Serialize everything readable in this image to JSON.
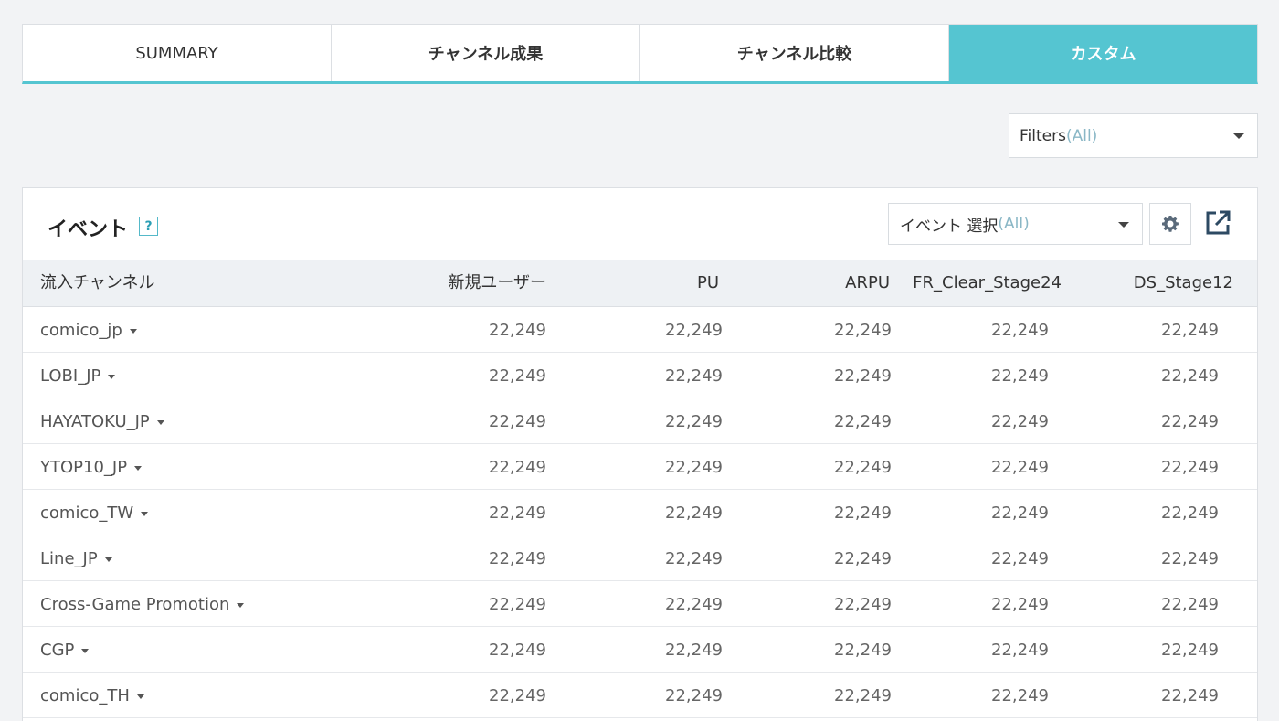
{
  "tabs": [
    {
      "label": "SUMMARY"
    },
    {
      "label": "チャンネル成果"
    },
    {
      "label": "チャンネル比較"
    },
    {
      "label": "カスタム"
    }
  ],
  "filters": {
    "label": "Filters",
    "value": "(All)"
  },
  "panel": {
    "title": "イベント",
    "help": "?",
    "event_select": {
      "label": "イベント 選択",
      "value": "(All)"
    }
  },
  "table": {
    "headers": [
      "流入チャンネル",
      "新規ユーザー",
      "PU",
      "ARPU",
      "FR_Clear_Stage24",
      "DS_Stage12"
    ],
    "rows": [
      {
        "channel": "comico_jp",
        "values": [
          "22,249",
          "22,249",
          "22,249",
          "22,249",
          "22,249"
        ]
      },
      {
        "channel": "LOBI_JP",
        "values": [
          "22,249",
          "22,249",
          "22,249",
          "22,249",
          "22,249"
        ]
      },
      {
        "channel": "HAYATOKU_JP",
        "values": [
          "22,249",
          "22,249",
          "22,249",
          "22,249",
          "22,249"
        ]
      },
      {
        "channel": "YTOP10_JP",
        "values": [
          "22,249",
          "22,249",
          "22,249",
          "22,249",
          "22,249"
        ]
      },
      {
        "channel": "comico_TW",
        "values": [
          "22,249",
          "22,249",
          "22,249",
          "22,249",
          "22,249"
        ]
      },
      {
        "channel": "Line_JP",
        "values": [
          "22,249",
          "22,249",
          "22,249",
          "22,249",
          "22,249"
        ]
      },
      {
        "channel": "Cross-Game Promotion",
        "values": [
          "22,249",
          "22,249",
          "22,249",
          "22,249",
          "22,249"
        ]
      },
      {
        "channel": "CGP",
        "values": [
          "22,249",
          "22,249",
          "22,249",
          "22,249",
          "22,249"
        ]
      },
      {
        "channel": "comico_TH",
        "values": [
          "22,249",
          "22,249",
          "22,249",
          "22,249",
          "22,249"
        ]
      }
    ]
  },
  "colors": {
    "accent": "#55c5d1",
    "header_bg": "#eef1f4",
    "page_bg": "#f2f3f5"
  },
  "icons": {
    "gear": "gear-icon",
    "export": "external-link-icon",
    "dropdown": "caret-down-icon"
  }
}
